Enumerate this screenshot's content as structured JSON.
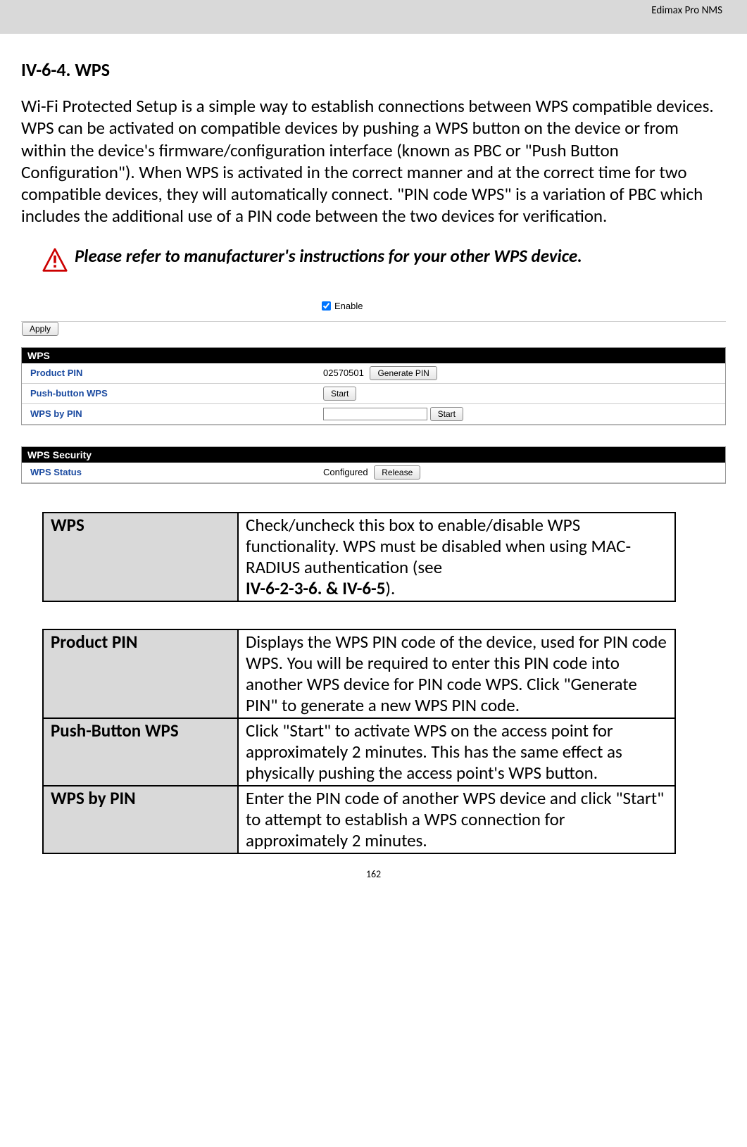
{
  "header": {
    "product": "Edimax Pro NMS"
  },
  "section": {
    "number_title": "IV-6-4. WPS",
    "intro": "Wi-Fi Protected Setup is a simple way to establish connections between WPS compatible devices. WPS can be activated on compatible devices by pushing a WPS button on the device or from within the device's firmware/configuration interface (known as PBC or \"Push Button Configuration\"). When WPS is activated in the correct manner and at the correct time for two compatible devices, they will automatically connect. \"PIN code WPS\" is a variation of PBC which includes the additional use of a PIN code between the two devices for verification.",
    "note": "Please refer to manufacturer's instructions for your other WPS device."
  },
  "ui1": {
    "wps_header": "WPS",
    "enable_label": "",
    "enable_text": "Enable",
    "apply_label": "Apply",
    "rows": {
      "product_pin_label": "Product PIN",
      "product_pin_value": "02570501",
      "generate_pin_label": "Generate PIN",
      "push_button_label": "Push-button WPS",
      "push_button_btn": "Start",
      "wps_by_pin_label": "WPS by PIN",
      "wps_by_pin_btn": "Start"
    }
  },
  "ui2": {
    "header": "WPS Security",
    "status_label": "WPS Status",
    "status_value": "Configured",
    "release_btn": "Release"
  },
  "tables": {
    "t1": {
      "r0c0": "WPS",
      "r0c1a": "Check/uncheck this box to enable/disable WPS functionality. WPS must be disabled when using MAC-RADIUS authentication (see",
      "r0c1b": "IV-6-2-3-6. & IV-6-5",
      "r0c1c": ")."
    },
    "t2": {
      "r0c0": "Product PIN",
      "r0c1": "Displays the WPS PIN code of the device, used for PIN code WPS. You will be required to enter this PIN code into another WPS device for PIN code WPS. Click \"Generate PIN\" to generate a new WPS PIN code.",
      "r1c0": "Push-Button WPS",
      "r1c1": "Click \"Start\" to activate WPS on the access point for approximately 2 minutes. This has the same effect as physically pushing the access point's WPS button.",
      "r2c0": "WPS by PIN",
      "r2c1": "Enter the PIN code of another WPS device and click \"Start\" to attempt to establish a WPS connection for approximately 2 minutes."
    }
  },
  "page_number": "162"
}
